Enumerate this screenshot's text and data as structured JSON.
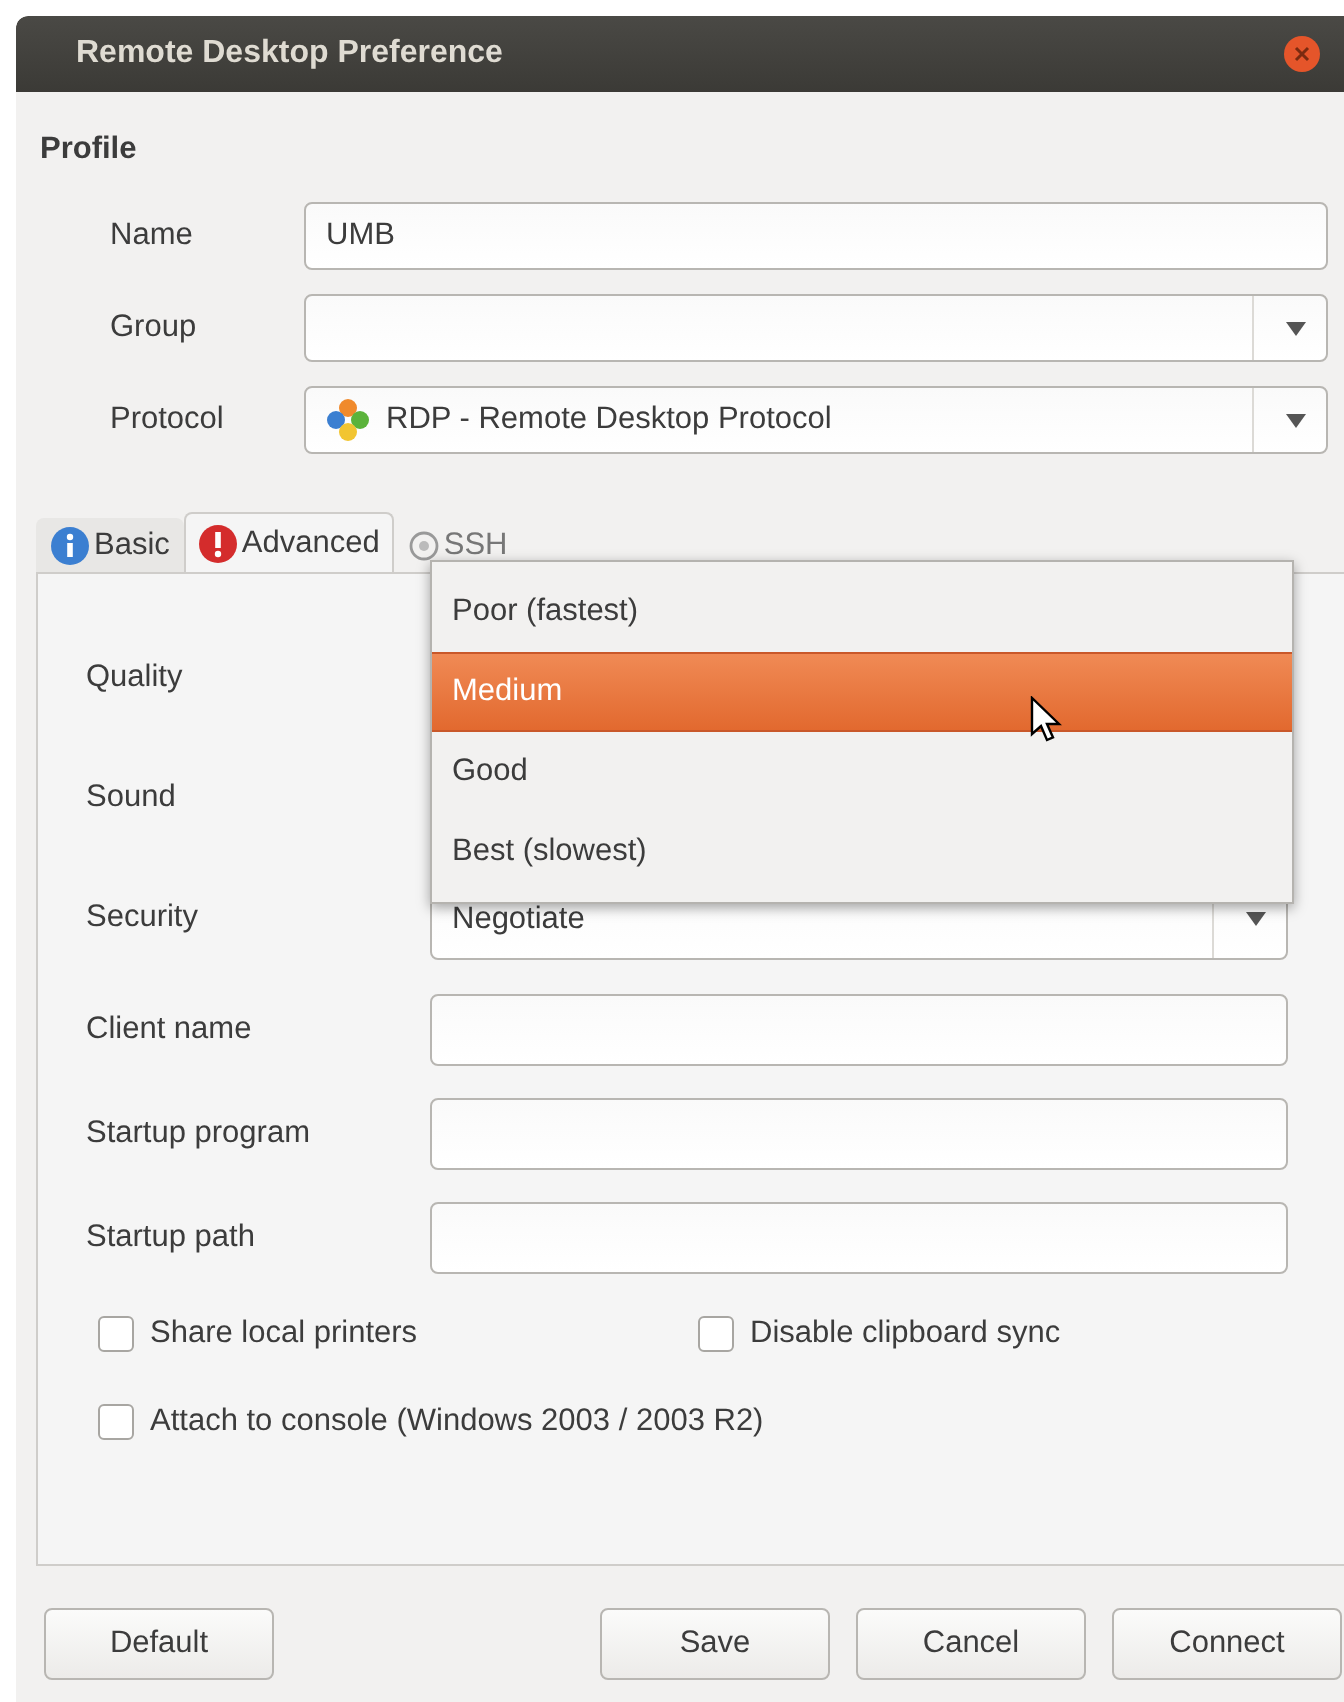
{
  "window": {
    "title": "Remote Desktop Preference"
  },
  "profile": {
    "heading": "Profile",
    "fields": [
      {
        "label": "Name",
        "kind": "text",
        "value": "UMB"
      },
      {
        "label": "Group",
        "kind": "combo"
      },
      {
        "label": "Protocol",
        "kind": "combo",
        "value": "RDP - Remote Desktop Protocol"
      }
    ]
  },
  "tabs": [
    {
      "label": "Basic",
      "selected": false
    },
    {
      "label": "Advanced",
      "selected": true
    },
    {
      "label": "SSH",
      "selected": false
    }
  ],
  "advanced": {
    "rows": [
      {
        "label": "Quality",
        "kind": "covered"
      },
      {
        "label": "Sound",
        "kind": "covered"
      },
      {
        "label": "Security",
        "kind": "combo",
        "value": "Negotiate"
      },
      {
        "label": "Client name",
        "kind": "text"
      },
      {
        "label": "Startup program",
        "kind": "text"
      },
      {
        "label": "Startup path",
        "kind": "text"
      }
    ],
    "checkbox_rows": [
      [
        {
          "label": "Share local printers",
          "checked": false
        },
        {
          "label": "Disable clipboard sync",
          "checked": false
        }
      ],
      [
        {
          "label": "Attach to console (Windows 2003 / 2003 R2)",
          "checked": false
        }
      ]
    ]
  },
  "popup": {
    "items": [
      {
        "label": "Poor (fastest)",
        "selected": false
      },
      {
        "label": "Medium",
        "selected": true
      },
      {
        "label": "Good",
        "selected": false
      },
      {
        "label": "Best (slowest)",
        "selected": false
      }
    ]
  },
  "buttons": [
    {
      "label": "Default"
    },
    {
      "label": "Save"
    },
    {
      "label": "Cancel"
    },
    {
      "label": "Connect"
    }
  ]
}
